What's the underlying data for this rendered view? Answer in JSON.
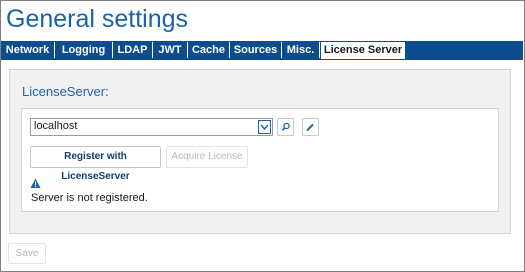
{
  "page": {
    "title": "General settings"
  },
  "tabs": [
    {
      "label": "Network"
    },
    {
      "label": "Logging"
    },
    {
      "label": "LDAP"
    },
    {
      "label": "JWT"
    },
    {
      "label": "Cache"
    },
    {
      "label": "Sources"
    },
    {
      "label": "Misc."
    },
    {
      "label": "License Server",
      "active": true
    }
  ],
  "license_server": {
    "heading": "LicenseServer:",
    "server_select": {
      "value": "localhost"
    },
    "icons": {
      "search": "search-icon",
      "edit": "edit-pencil-icon",
      "dropdown": "chevron-down-icon",
      "warning": "warning-triangle-icon"
    },
    "register_button": "Register with LicenseServer",
    "acquire_button": "Acquire License",
    "status_text": "Server is not registered."
  },
  "footer": {
    "save_button": "Save"
  },
  "colors": {
    "accent": "#1d62a8",
    "tabbar": "#0d4d8e",
    "panel": "#f1f1f1"
  }
}
